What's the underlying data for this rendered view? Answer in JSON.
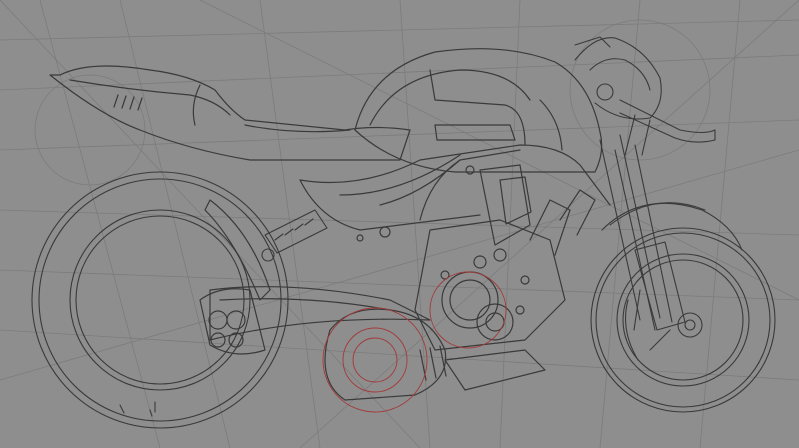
{
  "canvas": {
    "background": "#8e8e8e",
    "stroke_main": "#3a3a3a",
    "stroke_light": "#6e6e6e",
    "accent_red": "#a33a3a"
  },
  "sketch": {
    "subject": "motorcycle-sketch"
  }
}
